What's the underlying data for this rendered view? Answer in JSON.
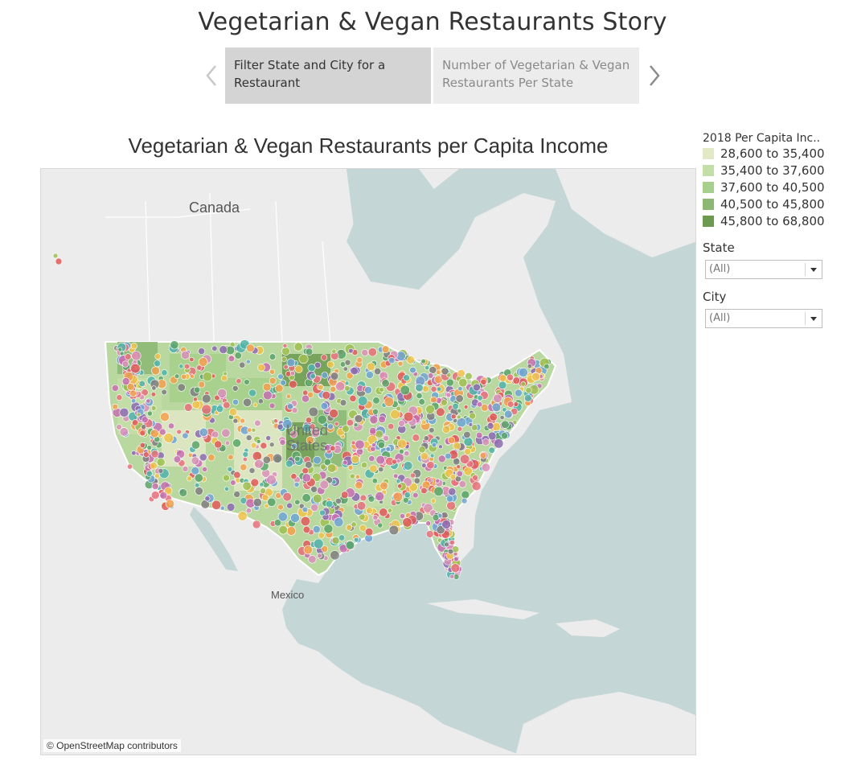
{
  "story": {
    "title": "Vegetarian & Vegan Restaurants Story",
    "points": [
      {
        "label": "Filter State and City for a Restaurant",
        "active": true
      },
      {
        "label": "Number of Vegetarian & Vegan Restaurants Per State",
        "active": false
      }
    ]
  },
  "viz": {
    "title": "Vegetarian & Vegan Restaurants per Capita Income"
  },
  "map": {
    "labels": {
      "canada": "Canada",
      "mexico": "Mexico",
      "us_line1": "United",
      "us_line2": "States"
    },
    "attribution": "© OpenStreetMap contributors",
    "colors": {
      "water": "#c5d6d6",
      "land": "#ececec",
      "border": "#ffffff"
    }
  },
  "legend": {
    "title": "2018 Per Capita Inc..",
    "items": [
      {
        "label": "28,600 to 35,400",
        "color": "#e1e9c7"
      },
      {
        "label": "35,400 to 37,600",
        "color": "#c4e0a8"
      },
      {
        "label": "37,600 to 40,500",
        "color": "#a6d08c"
      },
      {
        "label": "40,500 to 45,800",
        "color": "#8cb873"
      },
      {
        "label": "45,800 to 68,800",
        "color": "#6c9a50"
      }
    ]
  },
  "filters": {
    "state": {
      "label": "State",
      "value": "(All)"
    },
    "city": {
      "label": "City",
      "value": "(All)"
    }
  },
  "marker_colors": [
    "#e8707a",
    "#f3a04c",
    "#6fa4d2",
    "#5aa469",
    "#c76fb0",
    "#f0c24a",
    "#8c6bb1",
    "#e05a5a",
    "#4fb3a9",
    "#d98fb8",
    "#9fbf50",
    "#7f7f7f"
  ],
  "icons": {
    "prev": "chevron-left-icon",
    "next": "chevron-right-icon",
    "dropdown": "triangle-down-icon"
  }
}
